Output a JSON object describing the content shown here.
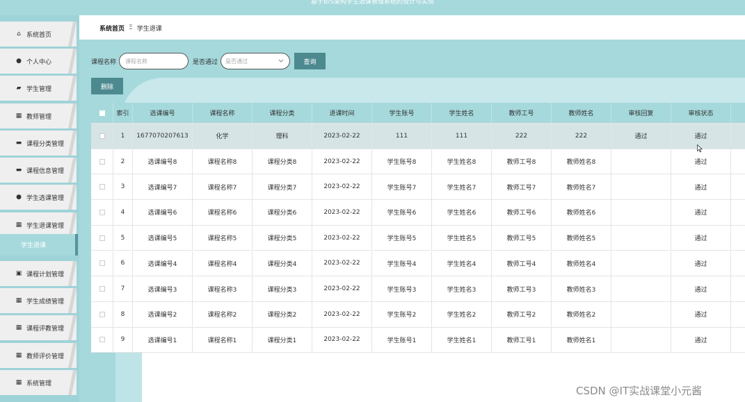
{
  "header": {
    "title": "基于B/S架构学生选课管理系统的设计与实现"
  },
  "sidebar": {
    "items": [
      {
        "icon": "home-icon",
        "glyph": "⌂",
        "label": "系统首页"
      },
      {
        "icon": "user-icon",
        "glyph": "●",
        "label": "个人中心"
      },
      {
        "icon": "thumb-icon",
        "glyph": "▰",
        "label": "学生管理"
      },
      {
        "icon": "grid-icon",
        "glyph": "▦",
        "label": "教师管理"
      },
      {
        "icon": "chat-icon",
        "glyph": "▬",
        "label": "课程分类管理"
      },
      {
        "icon": "card-icon",
        "glyph": "▬",
        "label": "课程信息管理"
      },
      {
        "icon": "user-icon",
        "glyph": "●",
        "label": "学生选课管理"
      },
      {
        "icon": "grid-icon",
        "glyph": "▦",
        "label": "学生退课管理"
      },
      {
        "icon": "clipboard-icon",
        "glyph": "▣",
        "label": "课程计划管理"
      },
      {
        "icon": "grid-icon",
        "glyph": "▦",
        "label": "学生成绩管理"
      },
      {
        "icon": "grid-icon",
        "glyph": "▦",
        "label": "课程评教管理"
      },
      {
        "icon": "grid-icon",
        "glyph": "▦",
        "label": "教师评价管理"
      },
      {
        "icon": "grid-icon",
        "glyph": "▦",
        "label": "系统管理"
      }
    ],
    "active_sub": "学生退课"
  },
  "breadcrumb": {
    "home": "系统首页",
    "separator": "Ξ",
    "current": "学生退课"
  },
  "search": {
    "course_label": "课程名称",
    "course_placeholder": "课程名称",
    "passed_label": "是否通过",
    "passed_placeholder": "是否通过",
    "query_button": "查询",
    "delete_button": "删除"
  },
  "table": {
    "headers": [
      "",
      "索引",
      "选课编号",
      "课程名称",
      "课程分类",
      "退课时间",
      "学生账号",
      "学生姓名",
      "教师工号",
      "教师姓名",
      "审核回复",
      "审核状态",
      ""
    ],
    "rows": [
      [
        "",
        "1",
        "1677070207613",
        "化学",
        "理科",
        "2023-02-22",
        "111",
        "111",
        "222",
        "222",
        "通过",
        "通过",
        ""
      ],
      [
        "",
        "2",
        "选课编号8",
        "课程名称8",
        "课程分类8",
        "2023-02-22",
        "学生账号8",
        "学生姓名8",
        "教师工号8",
        "教师姓名8",
        "",
        "通过",
        ""
      ],
      [
        "",
        "3",
        "选课编号7",
        "课程名称7",
        "课程分类7",
        "2023-02-22",
        "学生账号7",
        "学生姓名7",
        "教师工号7",
        "教师姓名7",
        "",
        "通过",
        ""
      ],
      [
        "",
        "4",
        "选课编号6",
        "课程名称6",
        "课程分类6",
        "2023-02-22",
        "学生账号6",
        "学生姓名6",
        "教师工号6",
        "教师姓名6",
        "",
        "通过",
        ""
      ],
      [
        "",
        "5",
        "选课编号5",
        "课程名称5",
        "课程分类5",
        "2023-02-22",
        "学生账号5",
        "学生姓名5",
        "教师工号5",
        "教师姓名5",
        "",
        "通过",
        ""
      ],
      [
        "",
        "6",
        "选课编号4",
        "课程名称4",
        "课程分类4",
        "2023-02-22",
        "学生账号4",
        "学生姓名4",
        "教师工号4",
        "教师姓名4",
        "",
        "通过",
        ""
      ],
      [
        "",
        "7",
        "选课编号3",
        "课程名称3",
        "课程分类3",
        "2023-02-22",
        "学生账号3",
        "学生姓名3",
        "教师工号3",
        "教师姓名3",
        "",
        "通过",
        ""
      ],
      [
        "",
        "8",
        "选课编号2",
        "课程名称2",
        "课程分类2",
        "2023-02-22",
        "学生账号2",
        "学生姓名2",
        "教师工号2",
        "教师姓名2",
        "",
        "通过",
        ""
      ],
      [
        "",
        "9",
        "选课编号1",
        "课程名称1",
        "课程分类1",
        "2023-02-22",
        "学生账号1",
        "学生姓名1",
        "教师工号1",
        "教师姓名1",
        "",
        "通过",
        ""
      ]
    ]
  },
  "watermark": "CSDN @IT实战课堂小元酱",
  "colors": {
    "accent": "#a6d9dc",
    "button": "#4d8a8f",
    "highlight_row": "#d6e4e6"
  }
}
